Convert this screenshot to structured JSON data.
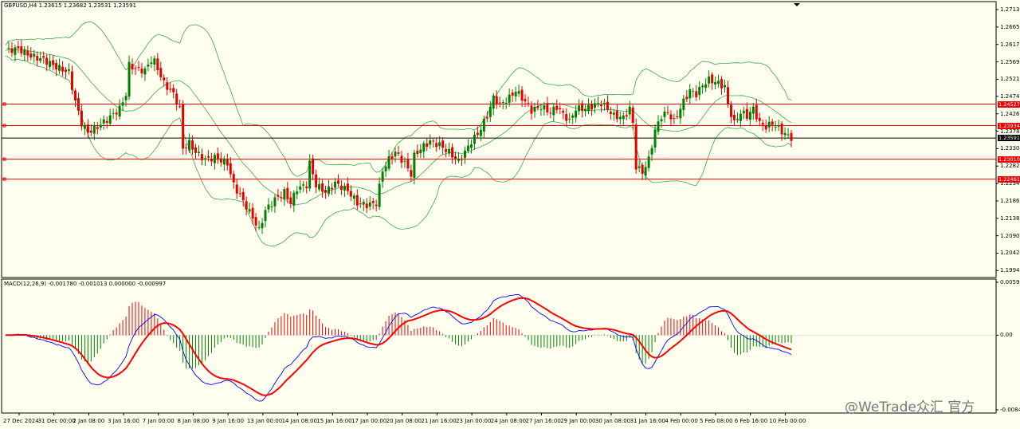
{
  "chart_data": {
    "type": "candlestick",
    "symbol_header": "GBPUSD,H4  1.23615 1.23682 1.23531 1.23591",
    "price_panel": {
      "ylim": [
        1.1975,
        1.2735
      ],
      "y_ticks": [
        "1.27130",
        "1.26650",
        "1.26170",
        "1.25690",
        "1.25210",
        "1.24740",
        "1.24260",
        "1.23780",
        "1.23300",
        "1.22820",
        "1.22340",
        "1.21860",
        "1.21380",
        "1.20900",
        "1.20420",
        "1.19940"
      ],
      "horizontal_lines": [
        {
          "value": 1.24527,
          "label": "1.24527",
          "color": "#e60000"
        },
        {
          "value": 1.23934,
          "label": "1.23934",
          "color": "#e60000"
        },
        {
          "value": 1.2301,
          "label": "1.23010",
          "color": "#e60000"
        },
        {
          "value": 1.22461,
          "label": "1.22461",
          "color": "#e60000"
        },
        {
          "value": 1.23591,
          "label": "1.23591",
          "color": "#000000"
        }
      ],
      "close_path": [
        [
          0,
          1.26
        ],
        [
          4,
          1.2605
        ],
        [
          8,
          1.2585
        ],
        [
          12,
          1.2575
        ],
        [
          16,
          1.2555
        ],
        [
          20,
          1.254
        ],
        [
          22,
          1.246
        ],
        [
          24,
          1.24
        ],
        [
          26,
          1.2375
        ],
        [
          29,
          1.239
        ],
        [
          32,
          1.241
        ],
        [
          36,
          1.244
        ],
        [
          38,
          1.248
        ],
        [
          39,
          1.256
        ],
        [
          41,
          1.255
        ],
        [
          44,
          1.2545
        ],
        [
          46,
          1.2575
        ],
        [
          47,
          1.257
        ],
        [
          50,
          1.251
        ],
        [
          53,
          1.248
        ],
        [
          55,
          1.244
        ],
        [
          56,
          1.233
        ],
        [
          58,
          1.2345
        ],
        [
          60,
          1.232
        ],
        [
          63,
          1.23
        ],
        [
          66,
          1.2305
        ],
        [
          70,
          1.229
        ],
        [
          72,
          1.223
        ],
        [
          75,
          1.2185
        ],
        [
          78,
          1.214
        ],
        [
          80,
          1.2105
        ],
        [
          82,
          1.216
        ],
        [
          85,
          1.219
        ],
        [
          88,
          1.221
        ],
        [
          90,
          1.218
        ],
        [
          92,
          1.222
        ],
        [
          95,
          1.223
        ],
        [
          96,
          1.229
        ],
        [
          98,
          1.223
        ],
        [
          101,
          1.221
        ],
        [
          104,
          1.2235
        ],
        [
          108,
          1.2215
        ],
        [
          111,
          1.218
        ],
        [
          114,
          1.2175
        ],
        [
          117,
          1.218
        ],
        [
          119,
          1.227
        ],
        [
          121,
          1.23
        ],
        [
          123,
          1.232
        ],
        [
          126,
          1.229
        ],
        [
          128,
          1.226
        ],
        [
          129,
          1.231
        ],
        [
          131,
          1.233
        ],
        [
          134,
          1.235
        ],
        [
          137,
          1.234
        ],
        [
          140,
          1.232
        ],
        [
          143,
          1.2295
        ],
        [
          145,
          1.232
        ],
        [
          147,
          1.235
        ],
        [
          149,
          1.237
        ],
        [
          152,
          1.242
        ],
        [
          154,
          1.247
        ],
        [
          156,
          1.245
        ],
        [
          159,
          1.247
        ],
        [
          161,
          1.249
        ],
        [
          163,
          1.247
        ],
        [
          166,
          1.2435
        ],
        [
          169,
          1.2445
        ],
        [
          172,
          1.243
        ],
        [
          174,
          1.2445
        ],
        [
          176,
          1.2425
        ],
        [
          178,
          1.2405
        ],
        [
          180,
          1.244
        ],
        [
          183,
          1.244
        ],
        [
          186,
          1.245
        ],
        [
          188,
          1.2455
        ],
        [
          190,
          1.244
        ],
        [
          192,
          1.242
        ],
        [
          195,
          1.2415
        ],
        [
          197,
          1.244
        ],
        [
          198,
          1.24
        ],
        [
          199,
          1.228
        ],
        [
          201,
          1.2265
        ],
        [
          203,
          1.23
        ],
        [
          205,
          1.238
        ],
        [
          207,
          1.242
        ],
        [
          209,
          1.243
        ],
        [
          211,
          1.2405
        ],
        [
          214,
          1.246
        ],
        [
          216,
          1.249
        ],
        [
          218,
          1.248
        ],
        [
          220,
          1.2505
        ],
        [
          222,
          1.252
        ],
        [
          225,
          1.251
        ],
        [
          227,
          1.25
        ],
        [
          228,
          1.245
        ],
        [
          230,
          1.24
        ],
        [
          232,
          1.243
        ],
        [
          234,
          1.242
        ],
        [
          236,
          1.244
        ],
        [
          238,
          1.24
        ],
        [
          240,
          1.239
        ],
        [
          242,
          1.24
        ],
        [
          244,
          1.2385
        ],
        [
          246,
          1.237
        ],
        [
          248,
          1.236
        ]
      ]
    },
    "macd_panel": {
      "header": "MACD(12,26,9) -0.001780 -0.001013 0.000000 -0.000997",
      "ylim": [
        -0.0086,
        0.0062
      ],
      "y_ticks": [
        "0.005946",
        "0.00",
        "-0.008460"
      ],
      "series": [
        {
          "color": "#0000ff"
        },
        {
          "color": "#ff0000"
        }
      ],
      "histogram_colors": {
        "positive": "#e60000",
        "negative": "#008000"
      }
    },
    "x_labels": [
      "27 Dec 2024",
      "31 Dec 00:00",
      "2 Jan 08:00",
      "3 Jan 16:00",
      "7 Jan 00:00",
      "8 Jan 08:00",
      "9 Jan 16:00",
      "13 Jan 00:00",
      "14 Jan 08:00",
      "15 Jan 16:00",
      "17 Jan 00:00",
      "20 Jan 08:00",
      "21 Jan 16:00",
      "23 Jan 00:00",
      "24 Jan 08:00",
      "27 Jan 16:00",
      "29 Jan 00:00",
      "30 Jan 08:00",
      "31 Jan 16:00",
      "4 Feb 00:00",
      "5 Feb 08:00",
      "6 Feb 16:00",
      "10 Feb 00:00"
    ]
  },
  "colors": {
    "background": "#fffff0",
    "bull": "#008000",
    "bear": "#e60000",
    "bands": "#3aa84a",
    "grid": "#000000"
  },
  "watermark": "@WeTrade众汇 官方"
}
